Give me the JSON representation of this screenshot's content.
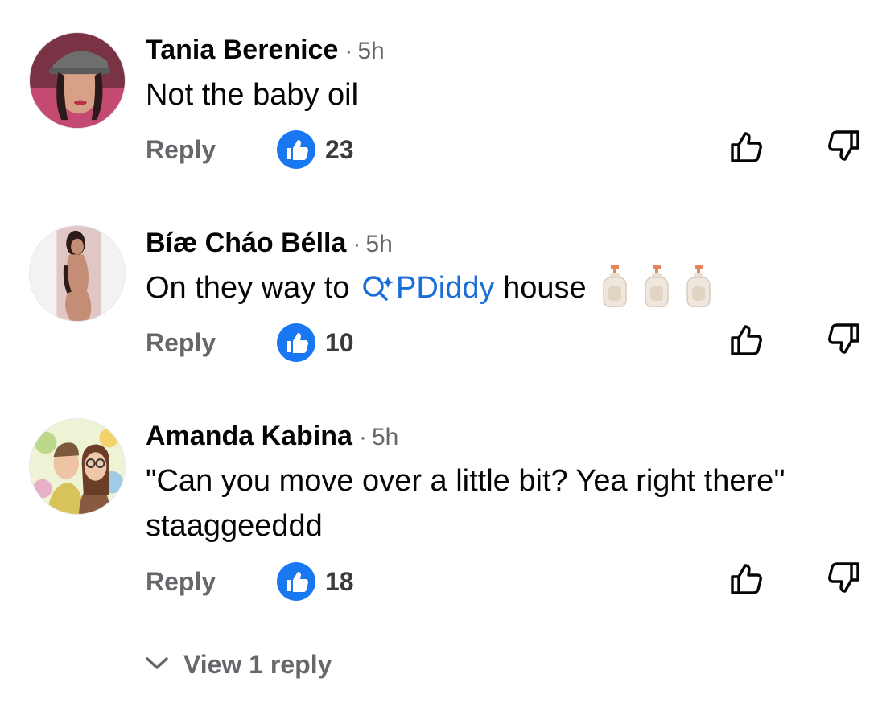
{
  "comments": [
    {
      "author": "Tania Berenice",
      "separator": "·",
      "time": "5h",
      "text": "Not the baby oil",
      "reply_label": "Reply",
      "like_count": "23",
      "avatar_icon": "avatar-woman-cap",
      "colors": {
        "avatar_bg": "#8a3b4c"
      }
    },
    {
      "author": "Bíæ Cháo Béllа",
      "separator": "·",
      "time": "5h",
      "text_before": "On they way to ",
      "mention": "PDiddy",
      "text_after": " house",
      "emoji": [
        "lotion-bottle-icon",
        "lotion-bottle-icon",
        "lotion-bottle-icon"
      ],
      "reply_label": "Reply",
      "like_count": "10",
      "avatar_icon": "avatar-woman-pink"
    },
    {
      "author": "Amanda Kabina",
      "separator": "·",
      "time": "5h",
      "text": "\"Can you move over a little bit? Yea right there'' staaggeeddd",
      "reply_label": "Reply",
      "like_count": "18",
      "avatar_icon": "avatar-couple-painting"
    }
  ],
  "view_replies": {
    "label": "View 1 reply",
    "icon": "chevron-down-icon"
  },
  "colors": {
    "link_blue": "#1a6ed8",
    "like_badge": "#1a77f2",
    "secondary_text": "#65676b"
  }
}
